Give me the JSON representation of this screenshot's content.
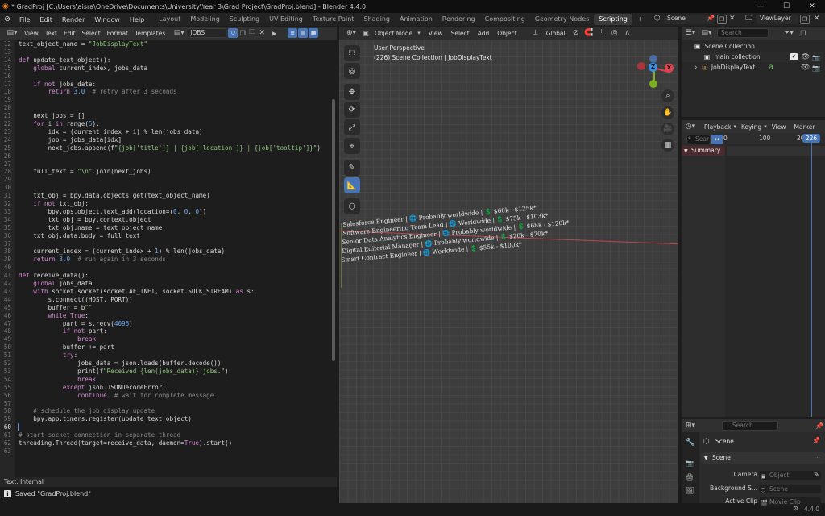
{
  "window": {
    "title": "* GradProj [C:\\Users\\aisra\\OneDrive\\Documents\\University\\Year 3\\Grad Project\\GradProj.blend] - Blender 4.4.0",
    "minimize": "—",
    "maximize": "☐",
    "close": "✕"
  },
  "menubar": {
    "menus": [
      "File",
      "Edit",
      "Render",
      "Window",
      "Help"
    ],
    "workspaces": [
      "Layout",
      "Modeling",
      "Sculpting",
      "UV Editing",
      "Texture Paint",
      "Shading",
      "Animation",
      "Rendering",
      "Compositing",
      "Geometry Nodes",
      "Scripting"
    ],
    "active_workspace": "Scripting",
    "add_tab": "+",
    "scene": "Scene",
    "view_layer": "ViewLayer"
  },
  "text_editor": {
    "menus": [
      "View",
      "Text",
      "Edit",
      "Select",
      "Format",
      "Templates"
    ],
    "text_name": "JOBS",
    "footer": "Text: Internal",
    "current_line": 60,
    "lines": [
      {
        "n": "12",
        "code": "text_object_name = \"JobDisplayText\""
      },
      {
        "n": "13",
        "code": ""
      },
      {
        "n": "14",
        "code": "def update_text_object():"
      },
      {
        "n": "15",
        "code": "    global current_index, jobs_data"
      },
      {
        "n": "16",
        "code": ""
      },
      {
        "n": "17",
        "code": "    if not jobs_data:"
      },
      {
        "n": "18",
        "code": "        return 3.0  # retry after 3 seconds"
      },
      {
        "n": "19",
        "code": ""
      },
      {
        "n": "20",
        "code": ""
      },
      {
        "n": "21",
        "code": "    next_jobs = []"
      },
      {
        "n": "22",
        "code": "    for i in range(5):"
      },
      {
        "n": "23",
        "code": "        idx = (current_index + i) % len(jobs_data)"
      },
      {
        "n": "24",
        "code": "        job = jobs_data[idx]"
      },
      {
        "n": "25",
        "code": "        next_jobs.append(f\"{job['title']} | {job['location']} | {job['tooltip']}\")"
      },
      {
        "n": "26",
        "code": ""
      },
      {
        "n": "27",
        "code": ""
      },
      {
        "n": "28",
        "code": "    full_text = \"\\n\".join(next_jobs)"
      },
      {
        "n": "29",
        "code": ""
      },
      {
        "n": "30",
        "code": ""
      },
      {
        "n": "31",
        "code": "    txt_obj = bpy.data.objects.get(text_object_name)"
      },
      {
        "n": "32",
        "code": "    if not txt_obj:"
      },
      {
        "n": "33",
        "code": "        bpy.ops.object.text_add(location=(0, 0, 0))"
      },
      {
        "n": "34",
        "code": "        txt_obj = bpy.context.object"
      },
      {
        "n": "35",
        "code": "        txt_obj.name = text_object_name"
      },
      {
        "n": "36",
        "code": "    txt_obj.data.body = full_text"
      },
      {
        "n": "37",
        "code": ""
      },
      {
        "n": "38",
        "code": "    current_index = (current_index + 1) % len(jobs_data)"
      },
      {
        "n": "39",
        "code": "    return 3.0  # run again in 3 seconds"
      },
      {
        "n": "40",
        "code": ""
      },
      {
        "n": "41",
        "code": "def receive_data():"
      },
      {
        "n": "42",
        "code": "    global jobs_data"
      },
      {
        "n": "43",
        "code": "    with socket.socket(socket.AF_INET, socket.SOCK_STREAM) as s:"
      },
      {
        "n": "44",
        "code": "        s.connect((HOST, PORT))"
      },
      {
        "n": "45",
        "code": "        buffer = b\"\""
      },
      {
        "n": "46",
        "code": "        while True:"
      },
      {
        "n": "47",
        "code": "            part = s.recv(4096)"
      },
      {
        "n": "48",
        "code": "            if not part:"
      },
      {
        "n": "49",
        "code": "                break"
      },
      {
        "n": "50",
        "code": "            buffer += part"
      },
      {
        "n": "51",
        "code": "            try:"
      },
      {
        "n": "52",
        "code": "                jobs_data = json.loads(buffer.decode())"
      },
      {
        "n": "53",
        "code": "                print(f\"Received {len(jobs_data)} jobs.\")"
      },
      {
        "n": "54",
        "code": "                break"
      },
      {
        "n": "55",
        "code": "            except json.JSONDecodeError:"
      },
      {
        "n": "56",
        "code": "                continue  # wait for complete message"
      },
      {
        "n": "57",
        "code": ""
      },
      {
        "n": "58",
        "code": "    # schedule the job display update"
      },
      {
        "n": "59",
        "code": "    bpy.app.timers.register(update_text_object)"
      },
      {
        "n": "60",
        "code": ""
      },
      {
        "n": "61",
        "code": "# start socket connection in separate thread"
      },
      {
        "n": "62",
        "code": "threading.Thread(target=receive_data, daemon=True).start()"
      },
      {
        "n": "63",
        "code": ""
      }
    ]
  },
  "status": {
    "message": "Saved \"GradProj.blend\"",
    "version": "4.4.0"
  },
  "viewport": {
    "mode": "Object Mode",
    "menus": [
      "View",
      "Select",
      "Add",
      "Object"
    ],
    "orientation": "Global",
    "overlay_title": "User Perspective",
    "overlay_subtitle": "(226) Scene Collection | JobDisplayText",
    "gizmo_x": "X",
    "gizmo_y": "Y",
    "gizmo_z": "Z",
    "job_lines": [
      "Salesforce Engineer | 🌐 Probably worldwide | 💲 $60k - $125k*",
      "Software Engineering Team Lead | 🌐 Worldwide | 💲 $75k - $103k*",
      "Senior Data Analytics Engineer | 🌐 Probably worldwide | 💲 $68k - $120k*",
      "Digital Editorial Manager | 🌐 Probably worldwide | 💲 $20k - $70k*",
      "Smart Contract Engineer | 🌐 Worldwide | 💲 $55k - $100k*"
    ]
  },
  "outliner": {
    "search_placeholder": "Search",
    "items": [
      {
        "label": "Scene Collection"
      },
      {
        "label": "main collection"
      },
      {
        "label": "JobDisplayText"
      }
    ]
  },
  "dopesheet": {
    "menus": [
      "Playback",
      "Keying",
      "View",
      "Marker"
    ],
    "search_placeholder": "Sear",
    "summary": "Summary",
    "frames": [
      "0",
      "100",
      "20"
    ],
    "current_frame": "226"
  },
  "properties": {
    "search_placeholder": "Search",
    "context_title": "Scene",
    "section": "Scene",
    "rows": [
      {
        "label": "Camera",
        "placeholder": "Object"
      },
      {
        "label": "Background S...",
        "placeholder": "Scene"
      },
      {
        "label": "Active Clip",
        "placeholder": "Movie Clip"
      }
    ]
  },
  "colors": {
    "accent": "#4774b5",
    "axis_x": "#e0434b",
    "axis_y": "#7fb01e",
    "axis_z": "#3d8ee0",
    "text_purple": "#d48ad2",
    "text_blue": "#6aa7ea",
    "text_green": "#8ec77a"
  }
}
